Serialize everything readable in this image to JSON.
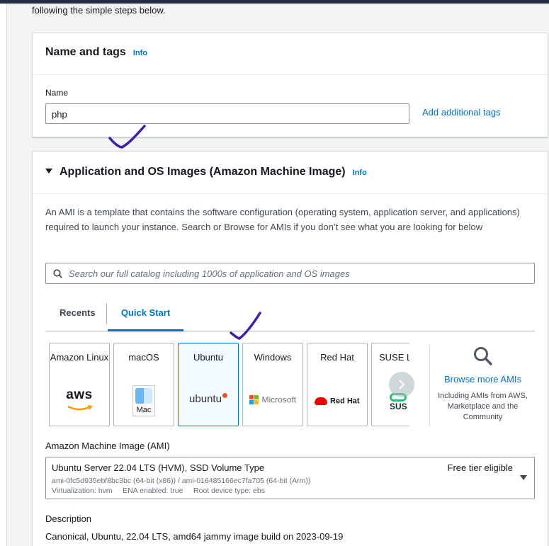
{
  "intro_text": "following the simple steps below.",
  "name_tags": {
    "title": "Name and tags",
    "info": "Info",
    "name_label": "Name",
    "name_value": "php",
    "add_tags": "Add additional tags"
  },
  "ami_section": {
    "title": "Application and OS Images (Amazon Machine Image)",
    "info": "Info",
    "description": "An AMI is a template that contains the software configuration (operating system, application server, and applications) required to launch your instance. Search or Browse for AMIs if you don’t see what you are looking for below",
    "search_placeholder": "Search our full catalog including 1000s of application and OS images",
    "tabs": [
      "Recents",
      "Quick Start"
    ],
    "tiles": {
      "amazon": {
        "name": "Amazon Linux",
        "logo": "aws"
      },
      "macos": {
        "name": "macOS",
        "logo": "Mac"
      },
      "ubuntu": {
        "name": "Ubuntu",
        "logo": "ubuntu"
      },
      "windows": {
        "name": "Windows",
        "logo": "Microsoft"
      },
      "redhat": {
        "name": "Red Hat",
        "logo": "Red Hat"
      },
      "suse": {
        "name": "SUSE Li",
        "logo": "SUS"
      }
    },
    "browse": {
      "title": "Browse more AMIs",
      "subtitle": "Including AMIs from AWS, Marketplace and the Community"
    },
    "ami_label": "Amazon Machine Image (AMI)",
    "ami_selected": {
      "title": "Ubuntu Server 22.04 LTS (HVM), SSD Volume Type",
      "ids": "ami-0fc5d935ebf8bc3bc (64-bit (x86)) / ami-016485166ec7fa705 (64-bit (Arm))",
      "meta": "Virtualization: hvm     ENA enabled: true     Root device type: ebs",
      "tier": "Free tier eligible"
    },
    "desc_label": "Description",
    "desc_value": "Canonical, Ubuntu, 22.04 LTS, amd64 jammy image build on 2023-09-19"
  },
  "colors": {
    "link": "#0073bb",
    "annotation": "#3d1fa6"
  }
}
